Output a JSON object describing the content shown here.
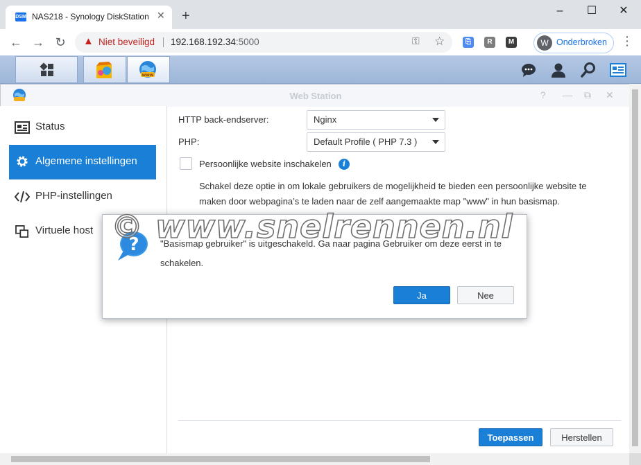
{
  "browser": {
    "tab_title": "NAS218 - Synology DiskStation",
    "tab_favicon_text": "DSM",
    "security_label": "Niet beveiligd",
    "url_host": "192.168.192.34",
    "url_port": ":5000",
    "profile_initial": "W",
    "profile_name": "Onderbroken",
    "ext_r_label": "R"
  },
  "window": {
    "title": "Web Station"
  },
  "sidebar": {
    "items": [
      {
        "label": "Status",
        "active": false
      },
      {
        "label": "Algemene instellingen",
        "active": true
      },
      {
        "label": "PHP-instellingen",
        "active": false
      },
      {
        "label": "Virtuele host",
        "active": false
      }
    ]
  },
  "form": {
    "http_backend_label": "HTTP back-endserver:",
    "http_backend_value": "Nginx",
    "php_label": "PHP:",
    "php_value": "Default Profile ( PHP 7.3 )",
    "personal_site_label": "Persoonlijke website inschakelen",
    "personal_site_checked": false,
    "description": "Schakel deze optie in om lokale gebruikers de mogelijkheid te bieden een persoonlijke website te maken door webpagina’s te laden naar de zelf aangemaakte map \"www\" in hun basismap."
  },
  "footer": {
    "apply_label": "Toepassen",
    "reset_label": "Herstellen"
  },
  "dialog": {
    "message": "\"Basismap gebruiker\" is uitgeschakeld. Ga naar pagina Gebruiker om deze eerst in te schakelen.",
    "yes_label": "Ja",
    "no_label": "Nee"
  },
  "watermark": "© www.snelrennen.nl",
  "colors": {
    "accent": "#1a7fd6",
    "insecure": "#c5221f",
    "taskbar": "#a8bfe0"
  },
  "icons": [
    "dsm-favicon-icon",
    "close-icon",
    "plus-icon",
    "back-icon",
    "forward-icon",
    "reload-icon",
    "warning-icon",
    "key-icon",
    "star-icon",
    "menu-icon",
    "grid-icon",
    "package-icon",
    "globe-icon",
    "chat-icon",
    "user-icon",
    "search-icon",
    "widget-icon",
    "status-icon",
    "gear-icon",
    "code-icon",
    "host-icon",
    "info-icon",
    "question-icon"
  ]
}
